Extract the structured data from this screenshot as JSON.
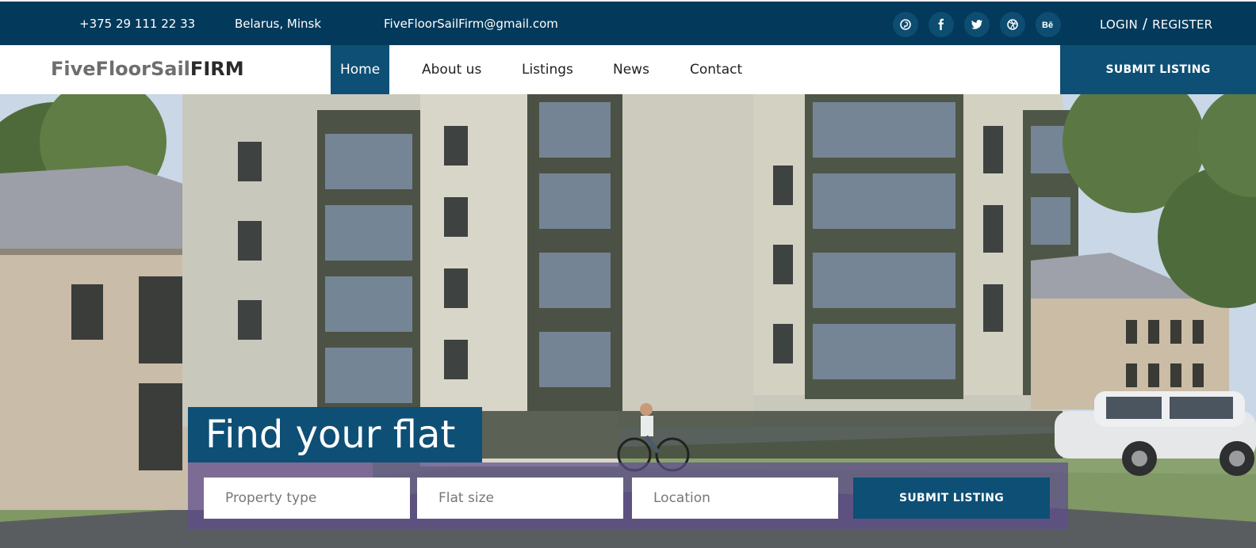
{
  "topbar": {
    "phone": "+375 29 111 22 33",
    "location": "Belarus, Minsk",
    "email": "FiveFloorSailFirm@gmail.com",
    "social": [
      "pinterest-icon",
      "facebook-icon",
      "twitter-icon",
      "dribbble-icon",
      "behance-icon"
    ],
    "login": "LOGIN",
    "separator": "/",
    "register": "REGISTER"
  },
  "nav": {
    "logo_part1": "FiveFloorSail",
    "logo_part2": "FIRM",
    "items": [
      "Home",
      "About us",
      "Listings",
      "News",
      "Contact"
    ],
    "active": "Home",
    "submit": "SUBMIT LISTING"
  },
  "hero": {
    "title": "Find your flat",
    "fields": {
      "property_type": "Property type",
      "flat_size": "Flat size",
      "location": "Location"
    },
    "submit": "SUBMIT LISTING"
  },
  "colors": {
    "topbar_bg": "#03395a",
    "accent": "#0e4f75",
    "panel": "#5e4c8c"
  }
}
